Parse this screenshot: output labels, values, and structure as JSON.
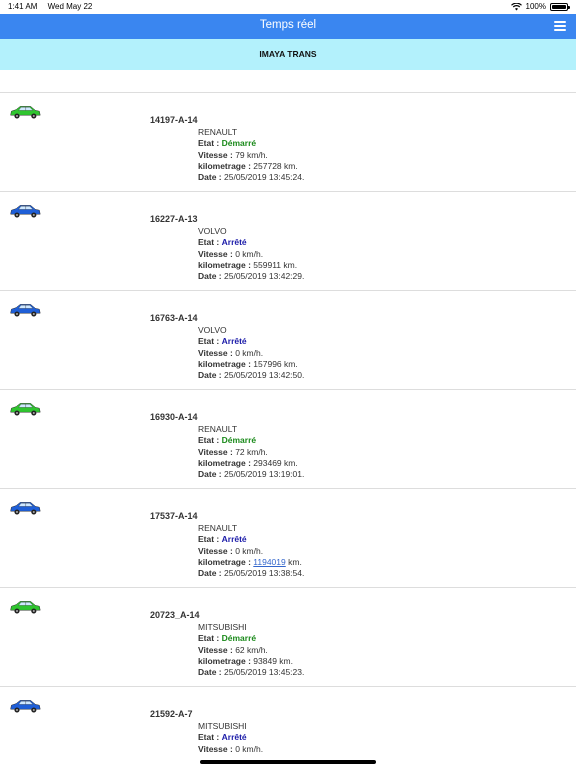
{
  "status": {
    "time": "1:41 AM",
    "date": "Wed May 22",
    "battery": "100%"
  },
  "nav": {
    "title": "Temps réel"
  },
  "company": {
    "name": "IMAYA TRANS"
  },
  "labels": {
    "etat": "Etat :",
    "vitesse": "Vitesse :",
    "km": "kilometrage :",
    "date": "Date :"
  },
  "colors": {
    "nav": "#3a86f0",
    "company_bar": "#b3f1fc",
    "started": "#1a8a1a",
    "stopped": "#1a1aa8",
    "car_green": "#2fc52f",
    "car_blue": "#1f5fd8"
  },
  "vehicles": [
    {
      "plate": "14197-A-14",
      "brand": "RENAULT",
      "state": "Démarré",
      "state_kind": "started",
      "car_color": "green",
      "speed": "79 km/h.",
      "km_value": "257728",
      "km_unit": "km.",
      "km_link": false,
      "date": "25/05/2019 13:45:24."
    },
    {
      "plate": "16227-A-13",
      "brand": "VOLVO",
      "state": "Arrêté",
      "state_kind": "stopped",
      "car_color": "blue",
      "speed": "0 km/h.",
      "km_value": "559911",
      "km_unit": "km.",
      "km_link": false,
      "date": "25/05/2019 13:42:29."
    },
    {
      "plate": "16763-A-14",
      "brand": "VOLVO",
      "state": "Arrêté",
      "state_kind": "stopped",
      "car_color": "blue",
      "speed": "0 km/h.",
      "km_value": "157996",
      "km_unit": "km.",
      "km_link": false,
      "date": "25/05/2019 13:42:50."
    },
    {
      "plate": "16930-A-14",
      "brand": "RENAULT",
      "state": "Démarré",
      "state_kind": "started",
      "car_color": "green",
      "speed": "72 km/h.",
      "km_value": "293469",
      "km_unit": "km.",
      "km_link": false,
      "date": "25/05/2019 13:19:01."
    },
    {
      "plate": "17537-A-14",
      "brand": "RENAULT",
      "state": "Arrêté",
      "state_kind": "stopped",
      "car_color": "blue",
      "speed": "0 km/h.",
      "km_value": "1194019",
      "km_unit": "km.",
      "km_link": true,
      "date": "25/05/2019 13:38:54."
    },
    {
      "plate": "20723_A-14",
      "brand": "MITSUBISHI",
      "state": "Démarré",
      "state_kind": "started",
      "car_color": "green",
      "speed": "62 km/h.",
      "km_value": "93849",
      "km_unit": "km.",
      "km_link": false,
      "date": "25/05/2019 13:45:23."
    },
    {
      "plate": "21592-A-7",
      "brand": "MITSUBISHI",
      "state": "Arrêté",
      "state_kind": "stopped",
      "car_color": "blue",
      "speed": "0 km/h.",
      "km_value": "",
      "km_unit": "",
      "km_link": false,
      "date": ""
    }
  ]
}
